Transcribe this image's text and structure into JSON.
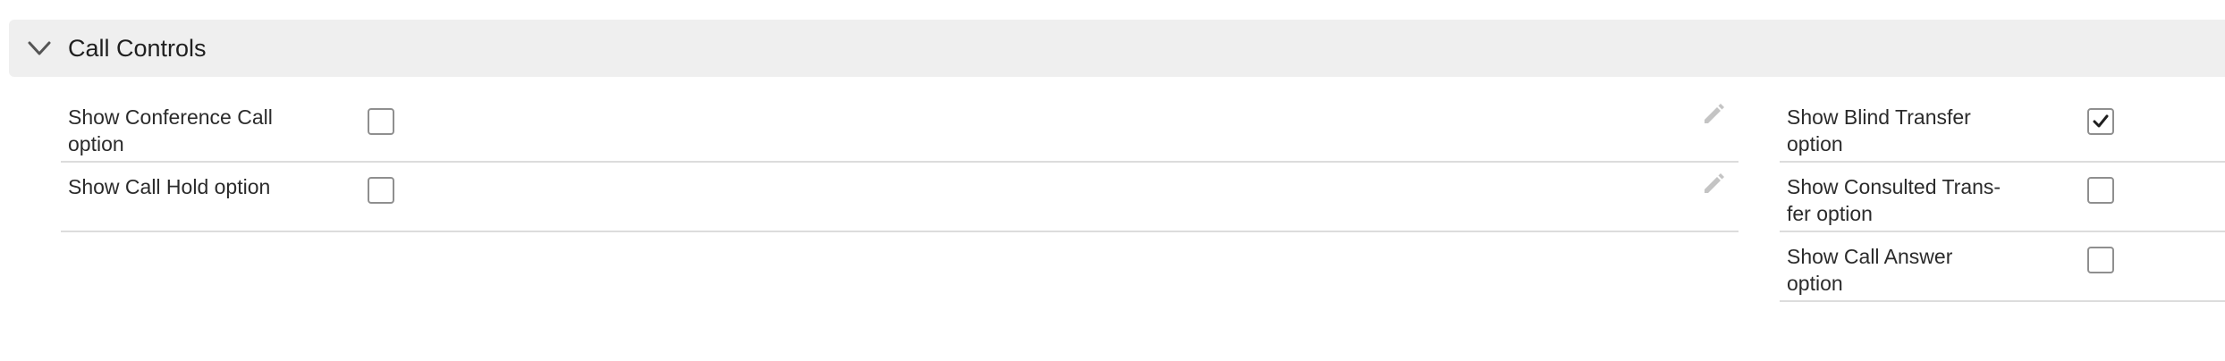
{
  "section": {
    "title": "Call Controls",
    "chevron_icon": "chevron-down-icon",
    "expanded": true
  },
  "left_column": {
    "fields": [
      {
        "label_line1": "Show Conference Call",
        "label_line2": "option",
        "checked": false,
        "edit_icon": "pencil-icon"
      },
      {
        "label_line1": "Show Call Hold option",
        "label_line2": "",
        "checked": false,
        "edit_icon": "pencil-icon"
      }
    ]
  },
  "right_column": {
    "fields": [
      {
        "label_line1": "Show Blind Transfer",
        "label_line2": "option",
        "checked": true
      },
      {
        "label_line1": "Show Consulted Trans-",
        "label_line2": "fer option",
        "checked": false
      },
      {
        "label_line1": "Show Call Answer",
        "label_line2": "option",
        "checked": false
      }
    ]
  },
  "colors": {
    "header_bg": "#efefef",
    "divider": "#dcdcdc",
    "checkbox_border": "#8f8f8f",
    "edit_icon": "#c4c4c4",
    "text": "#2b2b2b"
  }
}
